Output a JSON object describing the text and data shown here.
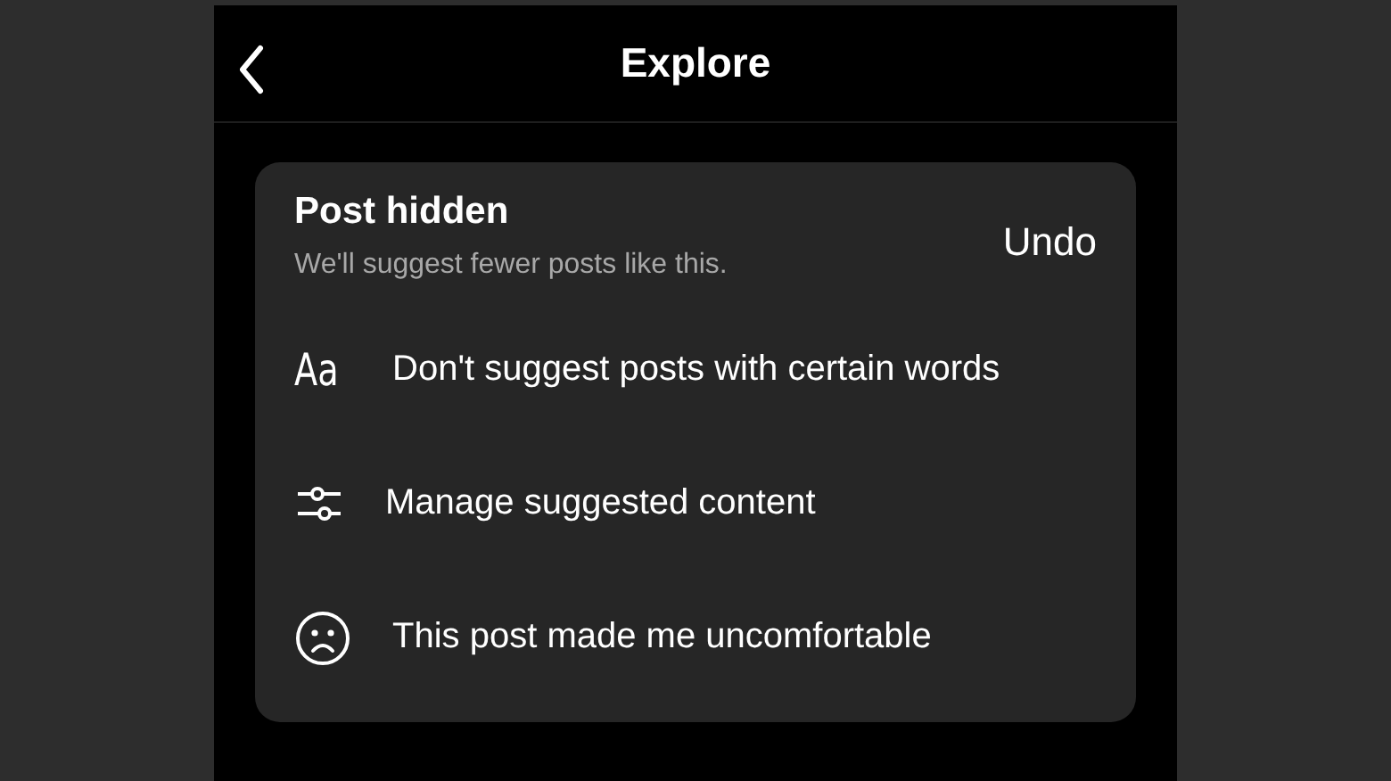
{
  "header": {
    "title": "Explore"
  },
  "notice": {
    "title": "Post hidden",
    "subtitle": "We'll suggest fewer posts like this.",
    "action": "Undo"
  },
  "options": [
    {
      "kind": "text",
      "icon_text": "Aa",
      "label": "Don't suggest posts with certain words"
    },
    {
      "kind": "sliders",
      "label": "Manage suggested content"
    },
    {
      "kind": "sad",
      "label": "This post made me uncomfortable"
    }
  ]
}
